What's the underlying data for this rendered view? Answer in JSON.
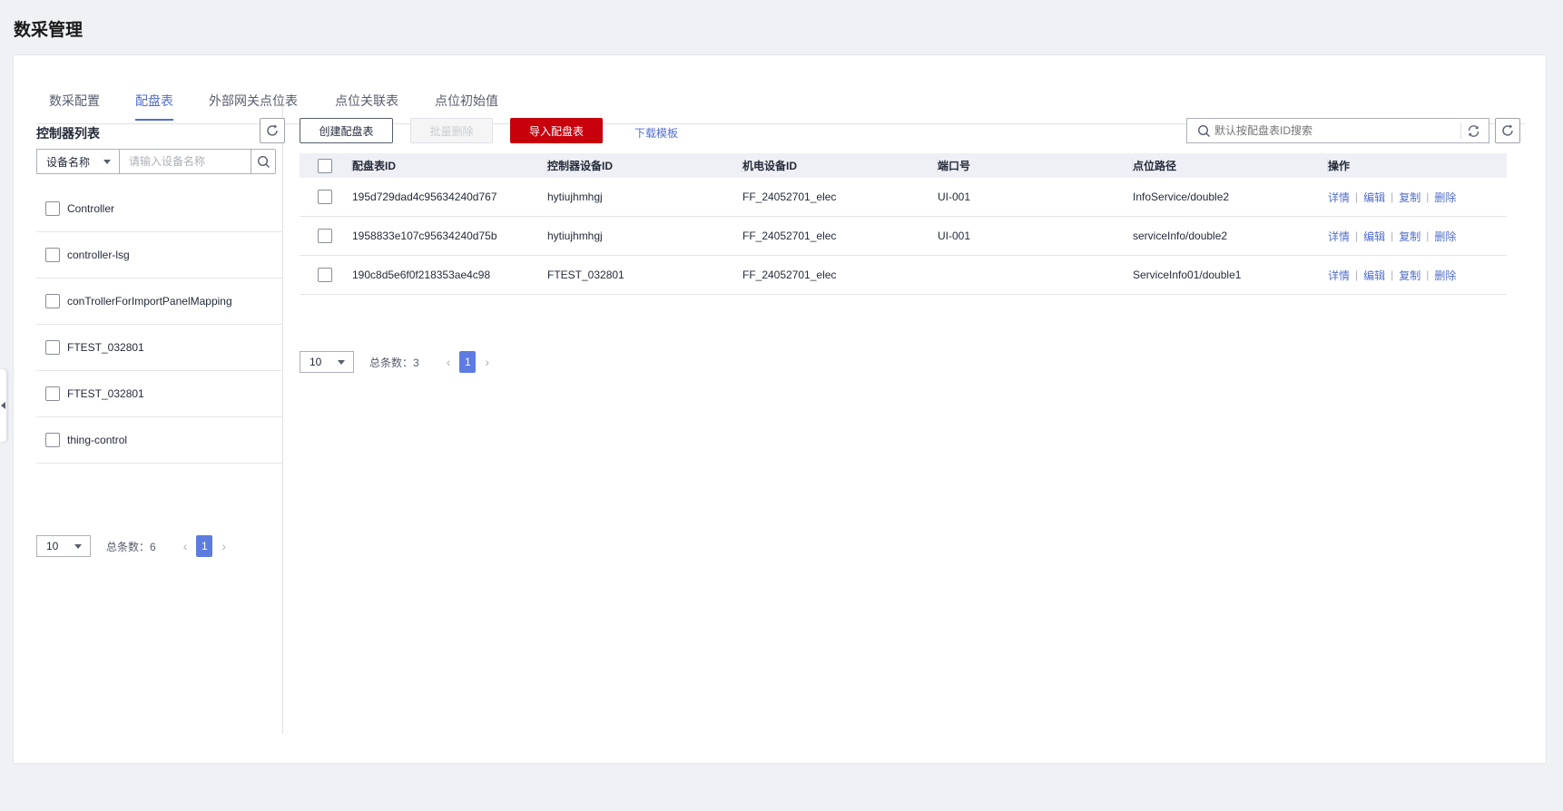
{
  "page": {
    "title": "数采管理"
  },
  "tabs": [
    {
      "label": "数采配置",
      "active": false
    },
    {
      "label": "配盘表",
      "active": true
    },
    {
      "label": "外部网关点位表",
      "active": false
    },
    {
      "label": "点位关联表",
      "active": false
    },
    {
      "label": "点位初始值",
      "active": false
    }
  ],
  "left_panel": {
    "title": "控制器列表",
    "filter_select": "设备名称",
    "search_placeholder": "请输入设备名称",
    "controllers": [
      {
        "name": "Controller"
      },
      {
        "name": "controller-lsg"
      },
      {
        "name": "conTrollerForImportPanelMapping"
      },
      {
        "name": "FTEST_032801"
      },
      {
        "name": "FTEST_032801"
      },
      {
        "name": "thing-control"
      }
    ],
    "pagination": {
      "page_size": "10",
      "total_label": "总条数：6",
      "current_page": "1"
    }
  },
  "toolbar": {
    "create_label": "创建配盘表",
    "batch_delete_label": "批量删除",
    "import_label": "导入配盘表",
    "download_label": "下载模板",
    "search_placeholder": "默认按配盘表ID搜索"
  },
  "table": {
    "columns": [
      "配盘表ID",
      "控制器设备ID",
      "机电设备ID",
      "端口号",
      "点位路径",
      "操作"
    ],
    "rows": [
      {
        "id": "195d729dad4c95634240d767",
        "controller_id": "hytiujhmhgj",
        "device_id": "FF_24052701_elec",
        "port": "UI-001",
        "path": "InfoService/double2"
      },
      {
        "id": "1958833e107c95634240d75b",
        "controller_id": "hytiujhmhgj",
        "device_id": "FF_24052701_elec",
        "port": "UI-001",
        "path": "serviceInfo/double2"
      },
      {
        "id": "190c8d5e6f0f218353ae4c98",
        "controller_id": "FTEST_032801",
        "device_id": "FF_24052701_elec",
        "port": "",
        "path": "ServiceInfo01/double1"
      }
    ],
    "actions": {
      "detail": "详情",
      "edit": "编辑",
      "copy": "复制",
      "delete": "删除"
    },
    "pagination": {
      "page_size": "10",
      "total_label": "总条数：3",
      "current_page": "1"
    }
  },
  "colors": {
    "primary": "#c7000b",
    "link": "#526ecc",
    "page_active": "#5e7ce0"
  },
  "icons": [
    "refresh-icon",
    "search-icon",
    "sync-icon",
    "caret-down-icon",
    "chevron-left-icon",
    "chevron-right-icon",
    "collapse-arrow-icon"
  ]
}
